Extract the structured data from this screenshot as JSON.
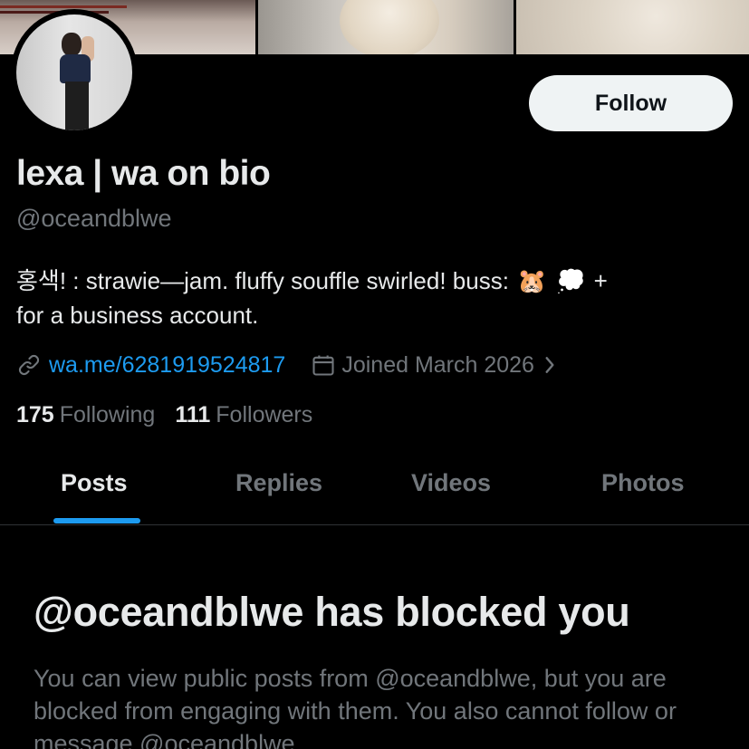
{
  "profile": {
    "display_name": "lexa | wa on bio",
    "handle": "@oceandblwe",
    "bio_line1_text": "홍색! : strawie—jam. fluffy souffle swirled! buss:",
    "bio_emoji_1": "🐹",
    "bio_emoji_2": "💭",
    "bio_line1_tail": "+",
    "bio_line2": "for a business account.",
    "link": "wa.me/6281919524817",
    "joined": "Joined March 2026",
    "following_count": "175",
    "following_label": "Following",
    "followers_count": "111",
    "followers_label": "Followers"
  },
  "actions": {
    "follow_label": "Follow"
  },
  "tabs": [
    {
      "label": "Posts",
      "active": true
    },
    {
      "label": "Replies",
      "active": false
    },
    {
      "label": "Videos",
      "active": false
    },
    {
      "label": "Photos",
      "active": false
    }
  ],
  "blocked": {
    "title": "@oceandblwe has blocked you",
    "body": "You can view public posts from @oceandblwe, but you are blocked from engaging with them. You also cannot follow or message @oceandblwe."
  },
  "icons": {
    "link": "link-icon",
    "calendar": "calendar-icon",
    "chevron": "chevron-right-icon"
  },
  "colors": {
    "background": "#000000",
    "text_primary": "#e7e9ea",
    "text_secondary": "#71767b",
    "accent": "#1d9bf0",
    "follow_button_bg": "#eff3f4"
  }
}
